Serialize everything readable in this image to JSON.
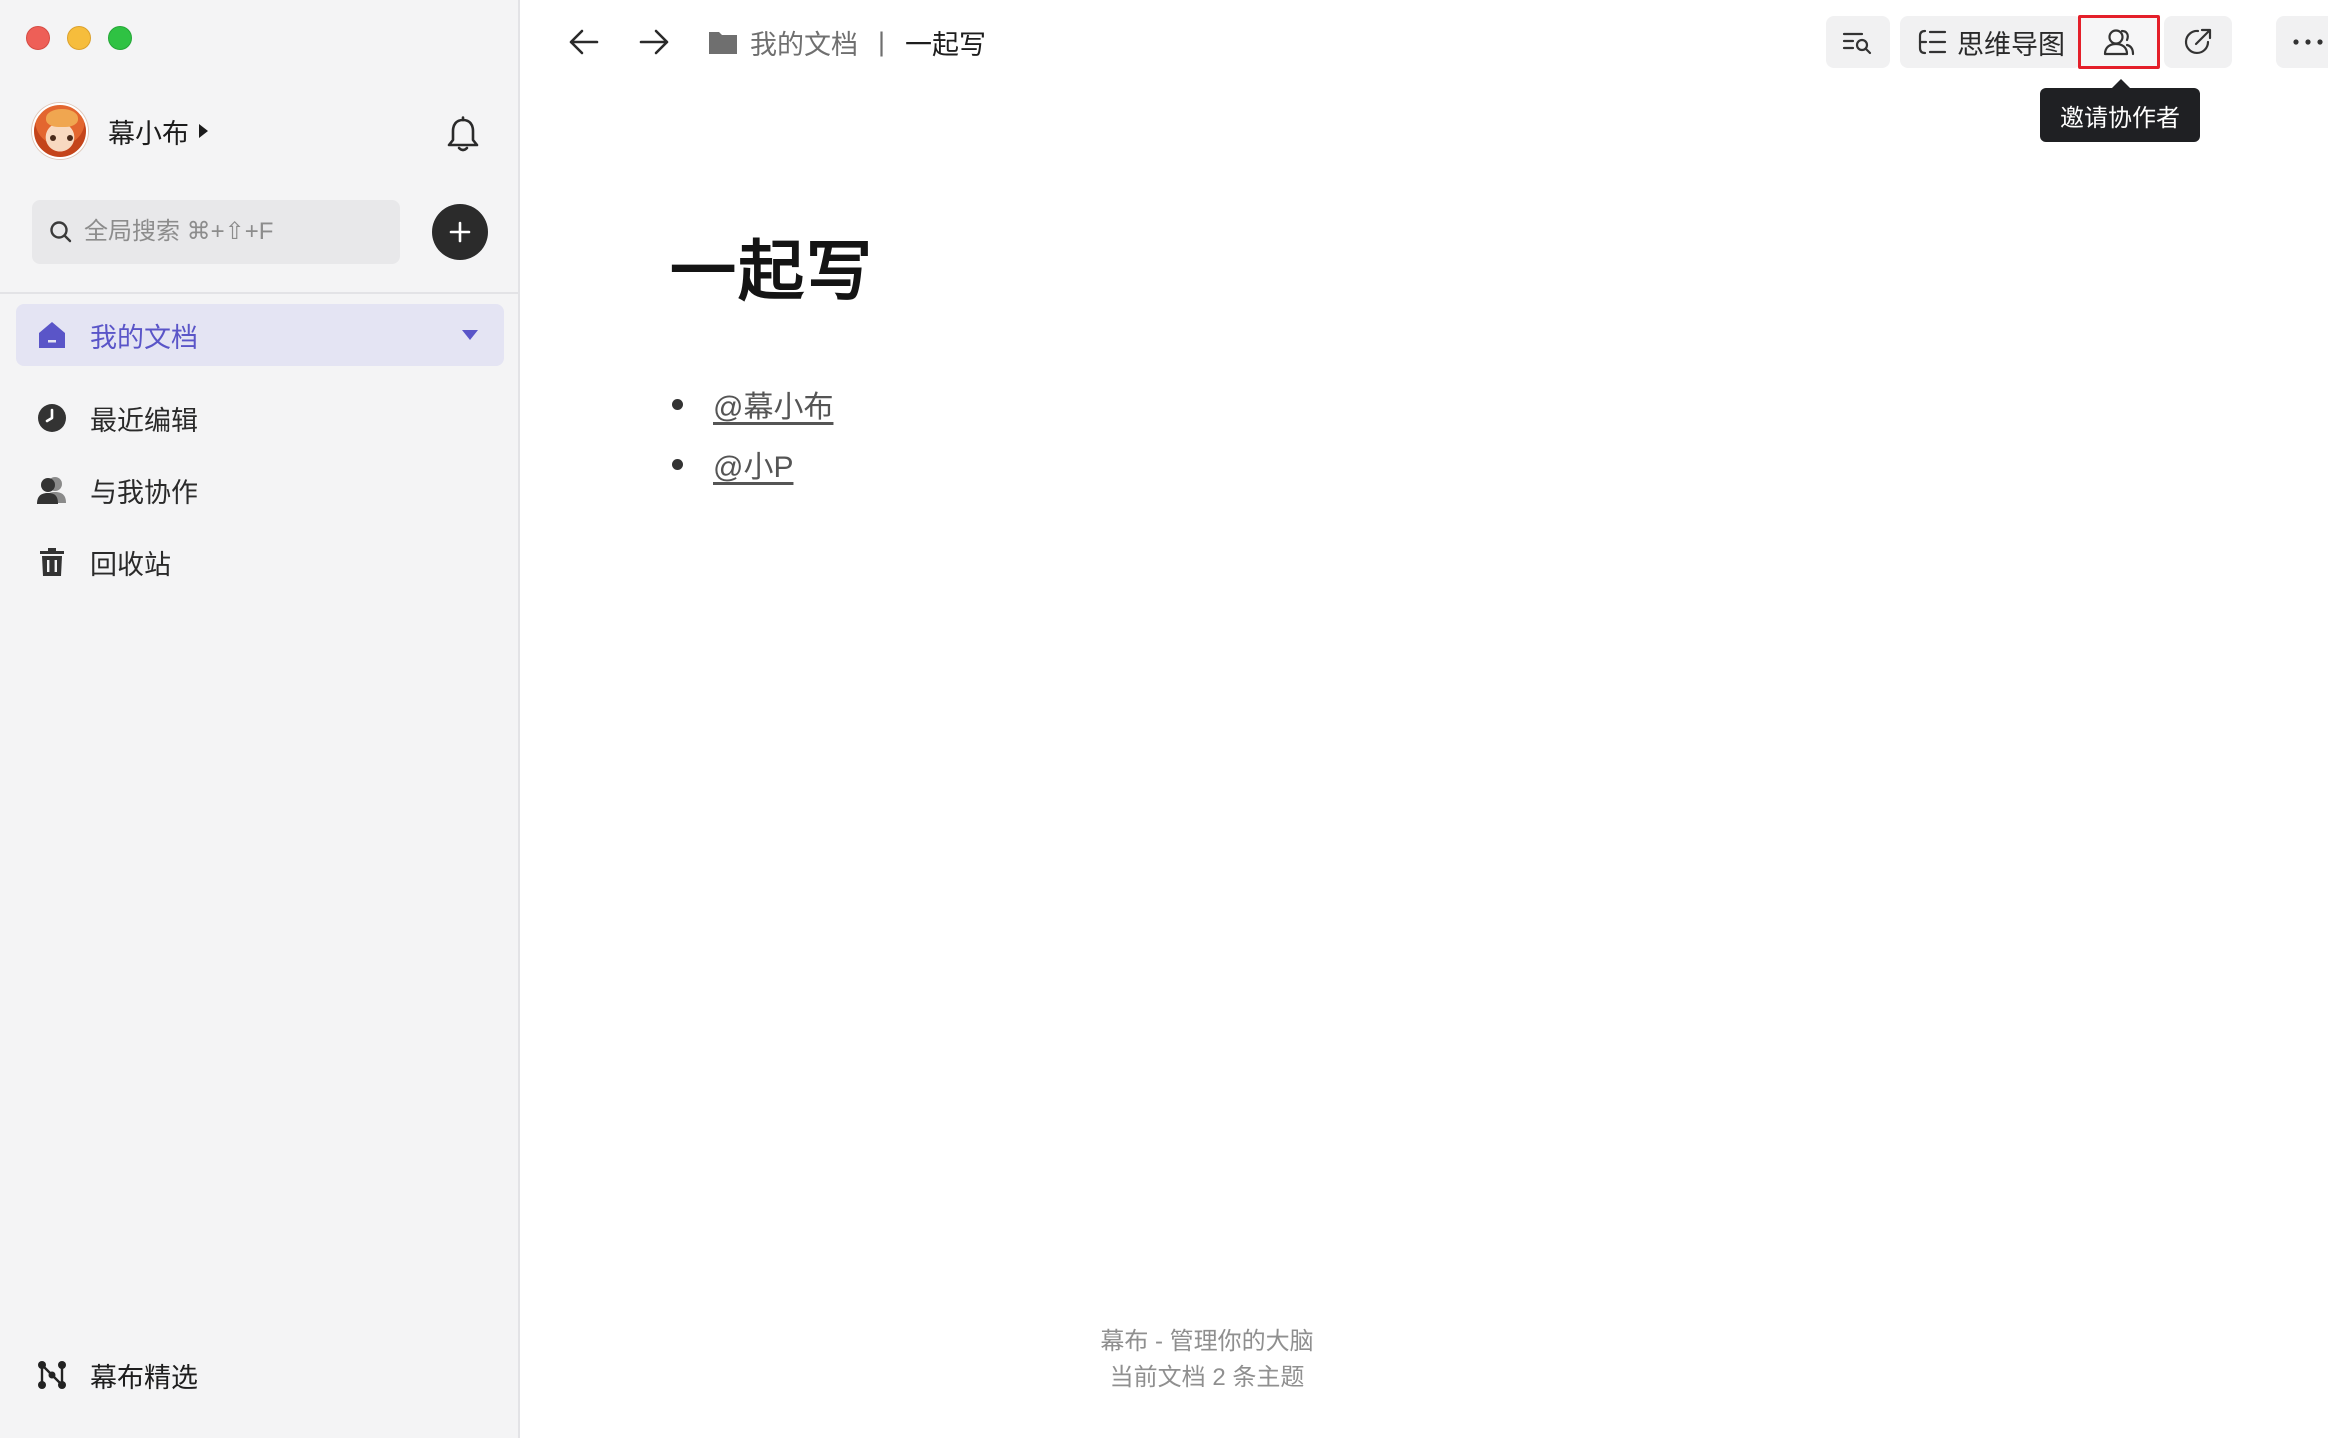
{
  "window": {
    "controls": [
      "close",
      "minimize",
      "zoom"
    ]
  },
  "sidebar": {
    "user": {
      "name": "幕小布",
      "avatar_icon": "anime-avatar"
    },
    "search": {
      "placeholder": "全局搜索 ⌘+⇧+F"
    },
    "nav": {
      "my_docs": {
        "label": "我的文档",
        "icon": "home-icon"
      },
      "recent": {
        "label": "最近编辑",
        "icon": "clock-icon"
      },
      "collab": {
        "label": "与我协作",
        "icon": "users-icon"
      },
      "trash": {
        "label": "回收站",
        "icon": "trash-icon"
      }
    },
    "featured": {
      "label": "幕布精选",
      "icon": "network-icon"
    }
  },
  "main": {
    "breadcrumb": {
      "root": "我的文档",
      "separator": "|",
      "current": "一起写"
    },
    "toolbar": {
      "mindmap_label": "思维导图",
      "invite_tooltip": "邀请协作者"
    },
    "document": {
      "title": "一起写",
      "items": [
        {
          "text": "@幕小布"
        },
        {
          "text": "@小P"
        }
      ]
    },
    "footer": {
      "line1": "幕布 - 管理你的大脑",
      "line2": "当前文档 2 条主题"
    }
  },
  "colors": {
    "accent": "#5a55c8",
    "accent_bg": "#e4e4f3",
    "highlight_border": "#e41f2a",
    "tooltip_bg": "#1f2023"
  }
}
